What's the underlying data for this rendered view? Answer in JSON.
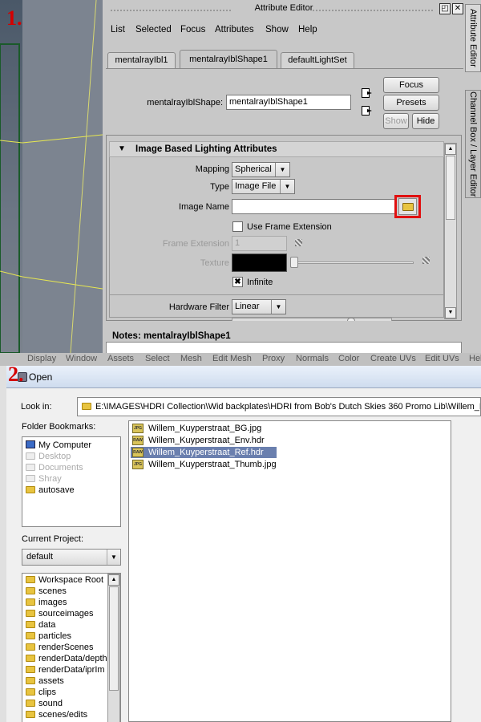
{
  "steps": {
    "one": "1.",
    "two": "2."
  },
  "attribute_editor": {
    "title": "Attribute Editor",
    "window_buttons": {
      "restore": "◰",
      "close": "✕"
    },
    "menu": [
      "List",
      "Selected",
      "Focus",
      "Attributes",
      "Show",
      "Help"
    ],
    "tabs": [
      {
        "label": "mentalrayIbl1",
        "active": false
      },
      {
        "label": "mentalrayIblShape1",
        "active": true
      },
      {
        "label": "defaultLightSet",
        "active": false
      }
    ],
    "node_label": "mentalrayIblShape:",
    "node_value": "mentalrayIblShape1",
    "buttons": {
      "focus": "Focus",
      "presets": "Presets",
      "show": "Show",
      "hide": "Hide"
    },
    "section_title": "Image Based Lighting Attributes",
    "mapping": {
      "label": "Mapping",
      "value": "Spherical"
    },
    "type": {
      "label": "Type",
      "value": "Image File"
    },
    "image_name": {
      "label": "Image Name",
      "value": ""
    },
    "use_frame_extension": {
      "label": "Use Frame Extension",
      "checked": false
    },
    "frame_extension": {
      "label": "Frame Extension",
      "value": "1"
    },
    "texture": {
      "label": "Texture",
      "color": "#000000"
    },
    "infinite": {
      "label": "Infinite",
      "checked": true
    },
    "hardware_filter": {
      "label": "Hardware Filter",
      "value": "Linear"
    },
    "notes_label": "Notes:  mentalrayIblShape1",
    "side_tabs": [
      "Attribute Editor",
      "Channel Box / Layer Editor"
    ],
    "highlight_color": "#e01010"
  },
  "maya_menu": [
    "Display",
    "Window",
    "Assets",
    "Select",
    "Mesh",
    "Edit Mesh",
    "Proxy",
    "Normals",
    "Color",
    "Create UVs",
    "Edit UVs",
    "Help"
  ],
  "open_dialog": {
    "title": "Open",
    "look_in_label": "Look in:",
    "look_in_path": "E:\\IMAGES\\HDRI Collection\\Wid backplates\\HDRI from Bob's Dutch Skies 360 Promo Lib\\Willem_Kuyperstraat",
    "folder_bookmarks_label": "Folder Bookmarks:",
    "bookmarks": [
      {
        "label": "My Computer",
        "disabled": false,
        "icon": "computer-icon"
      },
      {
        "label": "Desktop",
        "disabled": true,
        "icon": "folder-icon"
      },
      {
        "label": "Documents",
        "disabled": true,
        "icon": "folder-icon"
      },
      {
        "label": "Shray",
        "disabled": true,
        "icon": "folder-icon"
      },
      {
        "label": "autosave",
        "disabled": false,
        "icon": "folder-icon"
      }
    ],
    "current_project_label": "Current Project:",
    "current_project": "default",
    "project_folders": [
      "Workspace Root",
      "scenes",
      "images",
      "sourceimages",
      "data",
      "particles",
      "renderScenes",
      "renderData/depth",
      "renderData/iprIm",
      "assets",
      "clips",
      "sound",
      "scenes/edits"
    ],
    "files": [
      {
        "name": "Willem_Kuyperstraat_BG.jpg",
        "icon": "JPG",
        "selected": false
      },
      {
        "name": "Willem_Kuyperstraat_Env.hdr",
        "icon": "RAW",
        "selected": false
      },
      {
        "name": "Willem_Kuyperstraat_Ref.hdr",
        "icon": "RAW",
        "selected": true
      },
      {
        "name": "Willem_Kuyperstraat_Thumb.jpg",
        "icon": "JPG",
        "selected": false
      }
    ],
    "selection_color": "#6a7fae"
  }
}
